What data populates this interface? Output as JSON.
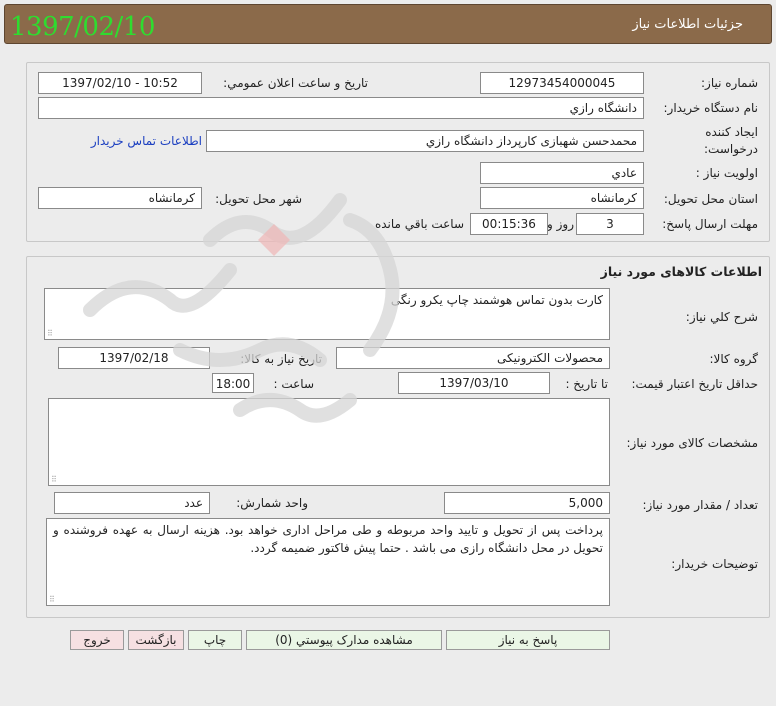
{
  "window": {
    "title": "جزئیات اطلاعات نیاز",
    "date_stamp": "1397/02/10"
  },
  "info": {
    "need_number_label": "شماره نیاز:",
    "need_number": "12973454000045",
    "announce_label": "تاریخ و ساعت اعلان عمومي:",
    "announce_value": "1397/02/10 - 10:52",
    "buyer_label": "نام دستگاه خریدار:",
    "buyer_value": "دانشگاه رازي",
    "creator_label_1": "ایجاد کننده",
    "creator_label_2": "درخواست:",
    "creator_value": "محمدحسن شهبازی کارپرداز دانشگاه رازي",
    "contact_link": "اطلاعات تماس خریدار",
    "priority_label": "اولویت نیاز :",
    "priority_value": "عادي",
    "province_label": "استان محل تحویل:",
    "province_value": "کرمانشاه",
    "city_label": "شهر محل تحویل:",
    "city_value": "کرمانشاه",
    "deadline_label": "مهلت ارسال پاسخ:",
    "days_value": "3",
    "days_text": "روز و",
    "time_value": "00:15:36",
    "remaining_text": "ساعت باقي مانده"
  },
  "goods": {
    "section_title": "اطلاعات کالاهای مورد نیاز",
    "desc_label": "شرح کلي نیاز:",
    "desc_value": "کارت بدون تماس هوشمند چاپ یکرو رنگی",
    "group_label": "گروه کالا:",
    "group_value": "محصولات الکترونیکی",
    "need_date_label": "تاریخ نیاز به کالا:",
    "need_date_value": "1397/02/18",
    "min_validity_label": "حداقل تاریخ اعتبار قیمت:",
    "until_date_label": "تا تاریخ :",
    "until_date_value": "1397/03/10",
    "hour_label": "ساعت :",
    "hour_value": "18:00",
    "specs_label": "مشخصات کالای مورد نیاز:",
    "specs_value": "",
    "qty_label": "تعداد / مقدار مورد نیاز:",
    "qty_value": "5,000",
    "unit_label": "واحد شمارش:",
    "unit_value": "عدد",
    "buyer_notes_label": "توضیحات خریدار:",
    "buyer_notes_value": "پرداخت پس از تحویل و تایید واحد مربوطه و طی مراحل اداری خواهد بود. هزینه ارسال به عهده فروشنده و تحویل در محل دانشگاه رازی می باشد . حتما پیش فاکتور ضمیمه گردد."
  },
  "buttons": {
    "reply": "پاسخ به نیاز",
    "attachments": "مشاهده مدارک پیوستي (0)",
    "print": "چاپ",
    "back": "بازگشت",
    "exit": "خروج"
  },
  "colors": {
    "titlebar": "#8b6a4a",
    "stamp": "#2fdc2f",
    "link": "#1a3ec0",
    "button_green": "#eaf6e6",
    "button_red": "#f6e0e2"
  }
}
